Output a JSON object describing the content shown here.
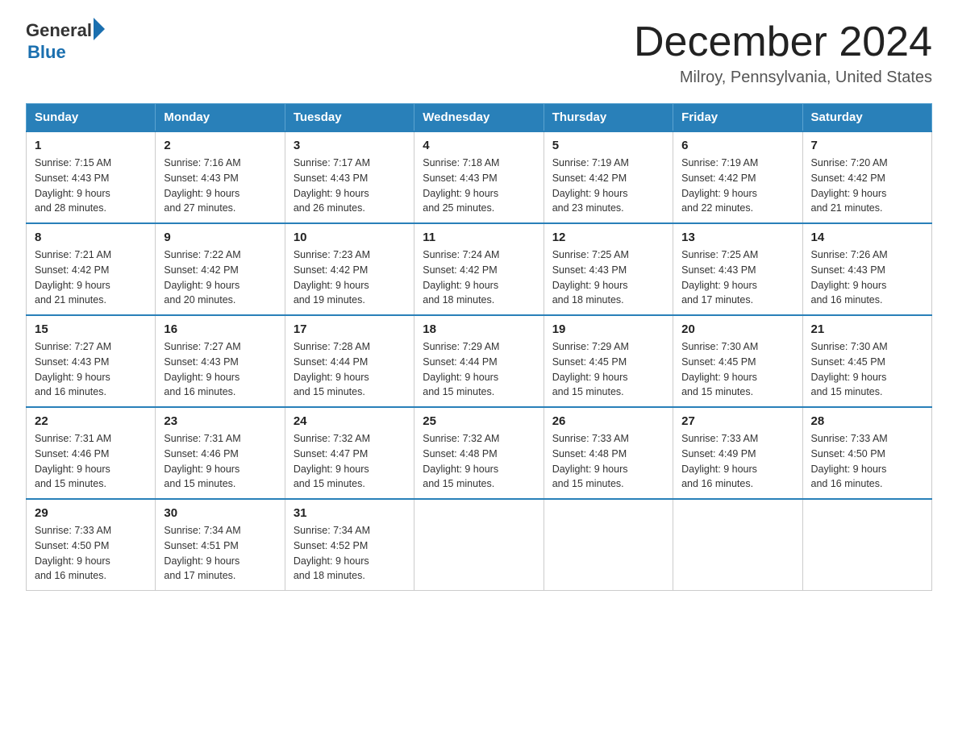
{
  "header": {
    "logo_general": "General",
    "logo_blue": "Blue",
    "title": "December 2024",
    "subtitle": "Milroy, Pennsylvania, United States"
  },
  "weekdays": [
    "Sunday",
    "Monday",
    "Tuesday",
    "Wednesday",
    "Thursday",
    "Friday",
    "Saturday"
  ],
  "weeks": [
    [
      {
        "day": "1",
        "sunrise": "7:15 AM",
        "sunset": "4:43 PM",
        "daylight": "9 hours and 28 minutes."
      },
      {
        "day": "2",
        "sunrise": "7:16 AM",
        "sunset": "4:43 PM",
        "daylight": "9 hours and 27 minutes."
      },
      {
        "day": "3",
        "sunrise": "7:17 AM",
        "sunset": "4:43 PM",
        "daylight": "9 hours and 26 minutes."
      },
      {
        "day": "4",
        "sunrise": "7:18 AM",
        "sunset": "4:43 PM",
        "daylight": "9 hours and 25 minutes."
      },
      {
        "day": "5",
        "sunrise": "7:19 AM",
        "sunset": "4:42 PM",
        "daylight": "9 hours and 23 minutes."
      },
      {
        "day": "6",
        "sunrise": "7:19 AM",
        "sunset": "4:42 PM",
        "daylight": "9 hours and 22 minutes."
      },
      {
        "day": "7",
        "sunrise": "7:20 AM",
        "sunset": "4:42 PM",
        "daylight": "9 hours and 21 minutes."
      }
    ],
    [
      {
        "day": "8",
        "sunrise": "7:21 AM",
        "sunset": "4:42 PM",
        "daylight": "9 hours and 21 minutes."
      },
      {
        "day": "9",
        "sunrise": "7:22 AM",
        "sunset": "4:42 PM",
        "daylight": "9 hours and 20 minutes."
      },
      {
        "day": "10",
        "sunrise": "7:23 AM",
        "sunset": "4:42 PM",
        "daylight": "9 hours and 19 minutes."
      },
      {
        "day": "11",
        "sunrise": "7:24 AM",
        "sunset": "4:42 PM",
        "daylight": "9 hours and 18 minutes."
      },
      {
        "day": "12",
        "sunrise": "7:25 AM",
        "sunset": "4:43 PM",
        "daylight": "9 hours and 18 minutes."
      },
      {
        "day": "13",
        "sunrise": "7:25 AM",
        "sunset": "4:43 PM",
        "daylight": "9 hours and 17 minutes."
      },
      {
        "day": "14",
        "sunrise": "7:26 AM",
        "sunset": "4:43 PM",
        "daylight": "9 hours and 16 minutes."
      }
    ],
    [
      {
        "day": "15",
        "sunrise": "7:27 AM",
        "sunset": "4:43 PM",
        "daylight": "9 hours and 16 minutes."
      },
      {
        "day": "16",
        "sunrise": "7:27 AM",
        "sunset": "4:43 PM",
        "daylight": "9 hours and 16 minutes."
      },
      {
        "day": "17",
        "sunrise": "7:28 AM",
        "sunset": "4:44 PM",
        "daylight": "9 hours and 15 minutes."
      },
      {
        "day": "18",
        "sunrise": "7:29 AM",
        "sunset": "4:44 PM",
        "daylight": "9 hours and 15 minutes."
      },
      {
        "day": "19",
        "sunrise": "7:29 AM",
        "sunset": "4:45 PM",
        "daylight": "9 hours and 15 minutes."
      },
      {
        "day": "20",
        "sunrise": "7:30 AM",
        "sunset": "4:45 PM",
        "daylight": "9 hours and 15 minutes."
      },
      {
        "day": "21",
        "sunrise": "7:30 AM",
        "sunset": "4:45 PM",
        "daylight": "9 hours and 15 minutes."
      }
    ],
    [
      {
        "day": "22",
        "sunrise": "7:31 AM",
        "sunset": "4:46 PM",
        "daylight": "9 hours and 15 minutes."
      },
      {
        "day": "23",
        "sunrise": "7:31 AM",
        "sunset": "4:46 PM",
        "daylight": "9 hours and 15 minutes."
      },
      {
        "day": "24",
        "sunrise": "7:32 AM",
        "sunset": "4:47 PM",
        "daylight": "9 hours and 15 minutes."
      },
      {
        "day": "25",
        "sunrise": "7:32 AM",
        "sunset": "4:48 PM",
        "daylight": "9 hours and 15 minutes."
      },
      {
        "day": "26",
        "sunrise": "7:33 AM",
        "sunset": "4:48 PM",
        "daylight": "9 hours and 15 minutes."
      },
      {
        "day": "27",
        "sunrise": "7:33 AM",
        "sunset": "4:49 PM",
        "daylight": "9 hours and 16 minutes."
      },
      {
        "day": "28",
        "sunrise": "7:33 AM",
        "sunset": "4:50 PM",
        "daylight": "9 hours and 16 minutes."
      }
    ],
    [
      {
        "day": "29",
        "sunrise": "7:33 AM",
        "sunset": "4:50 PM",
        "daylight": "9 hours and 16 minutes."
      },
      {
        "day": "30",
        "sunrise": "7:34 AM",
        "sunset": "4:51 PM",
        "daylight": "9 hours and 17 minutes."
      },
      {
        "day": "31",
        "sunrise": "7:34 AM",
        "sunset": "4:52 PM",
        "daylight": "9 hours and 18 minutes."
      },
      null,
      null,
      null,
      null
    ]
  ],
  "labels": {
    "sunrise": "Sunrise:",
    "sunset": "Sunset:",
    "daylight": "Daylight:"
  }
}
